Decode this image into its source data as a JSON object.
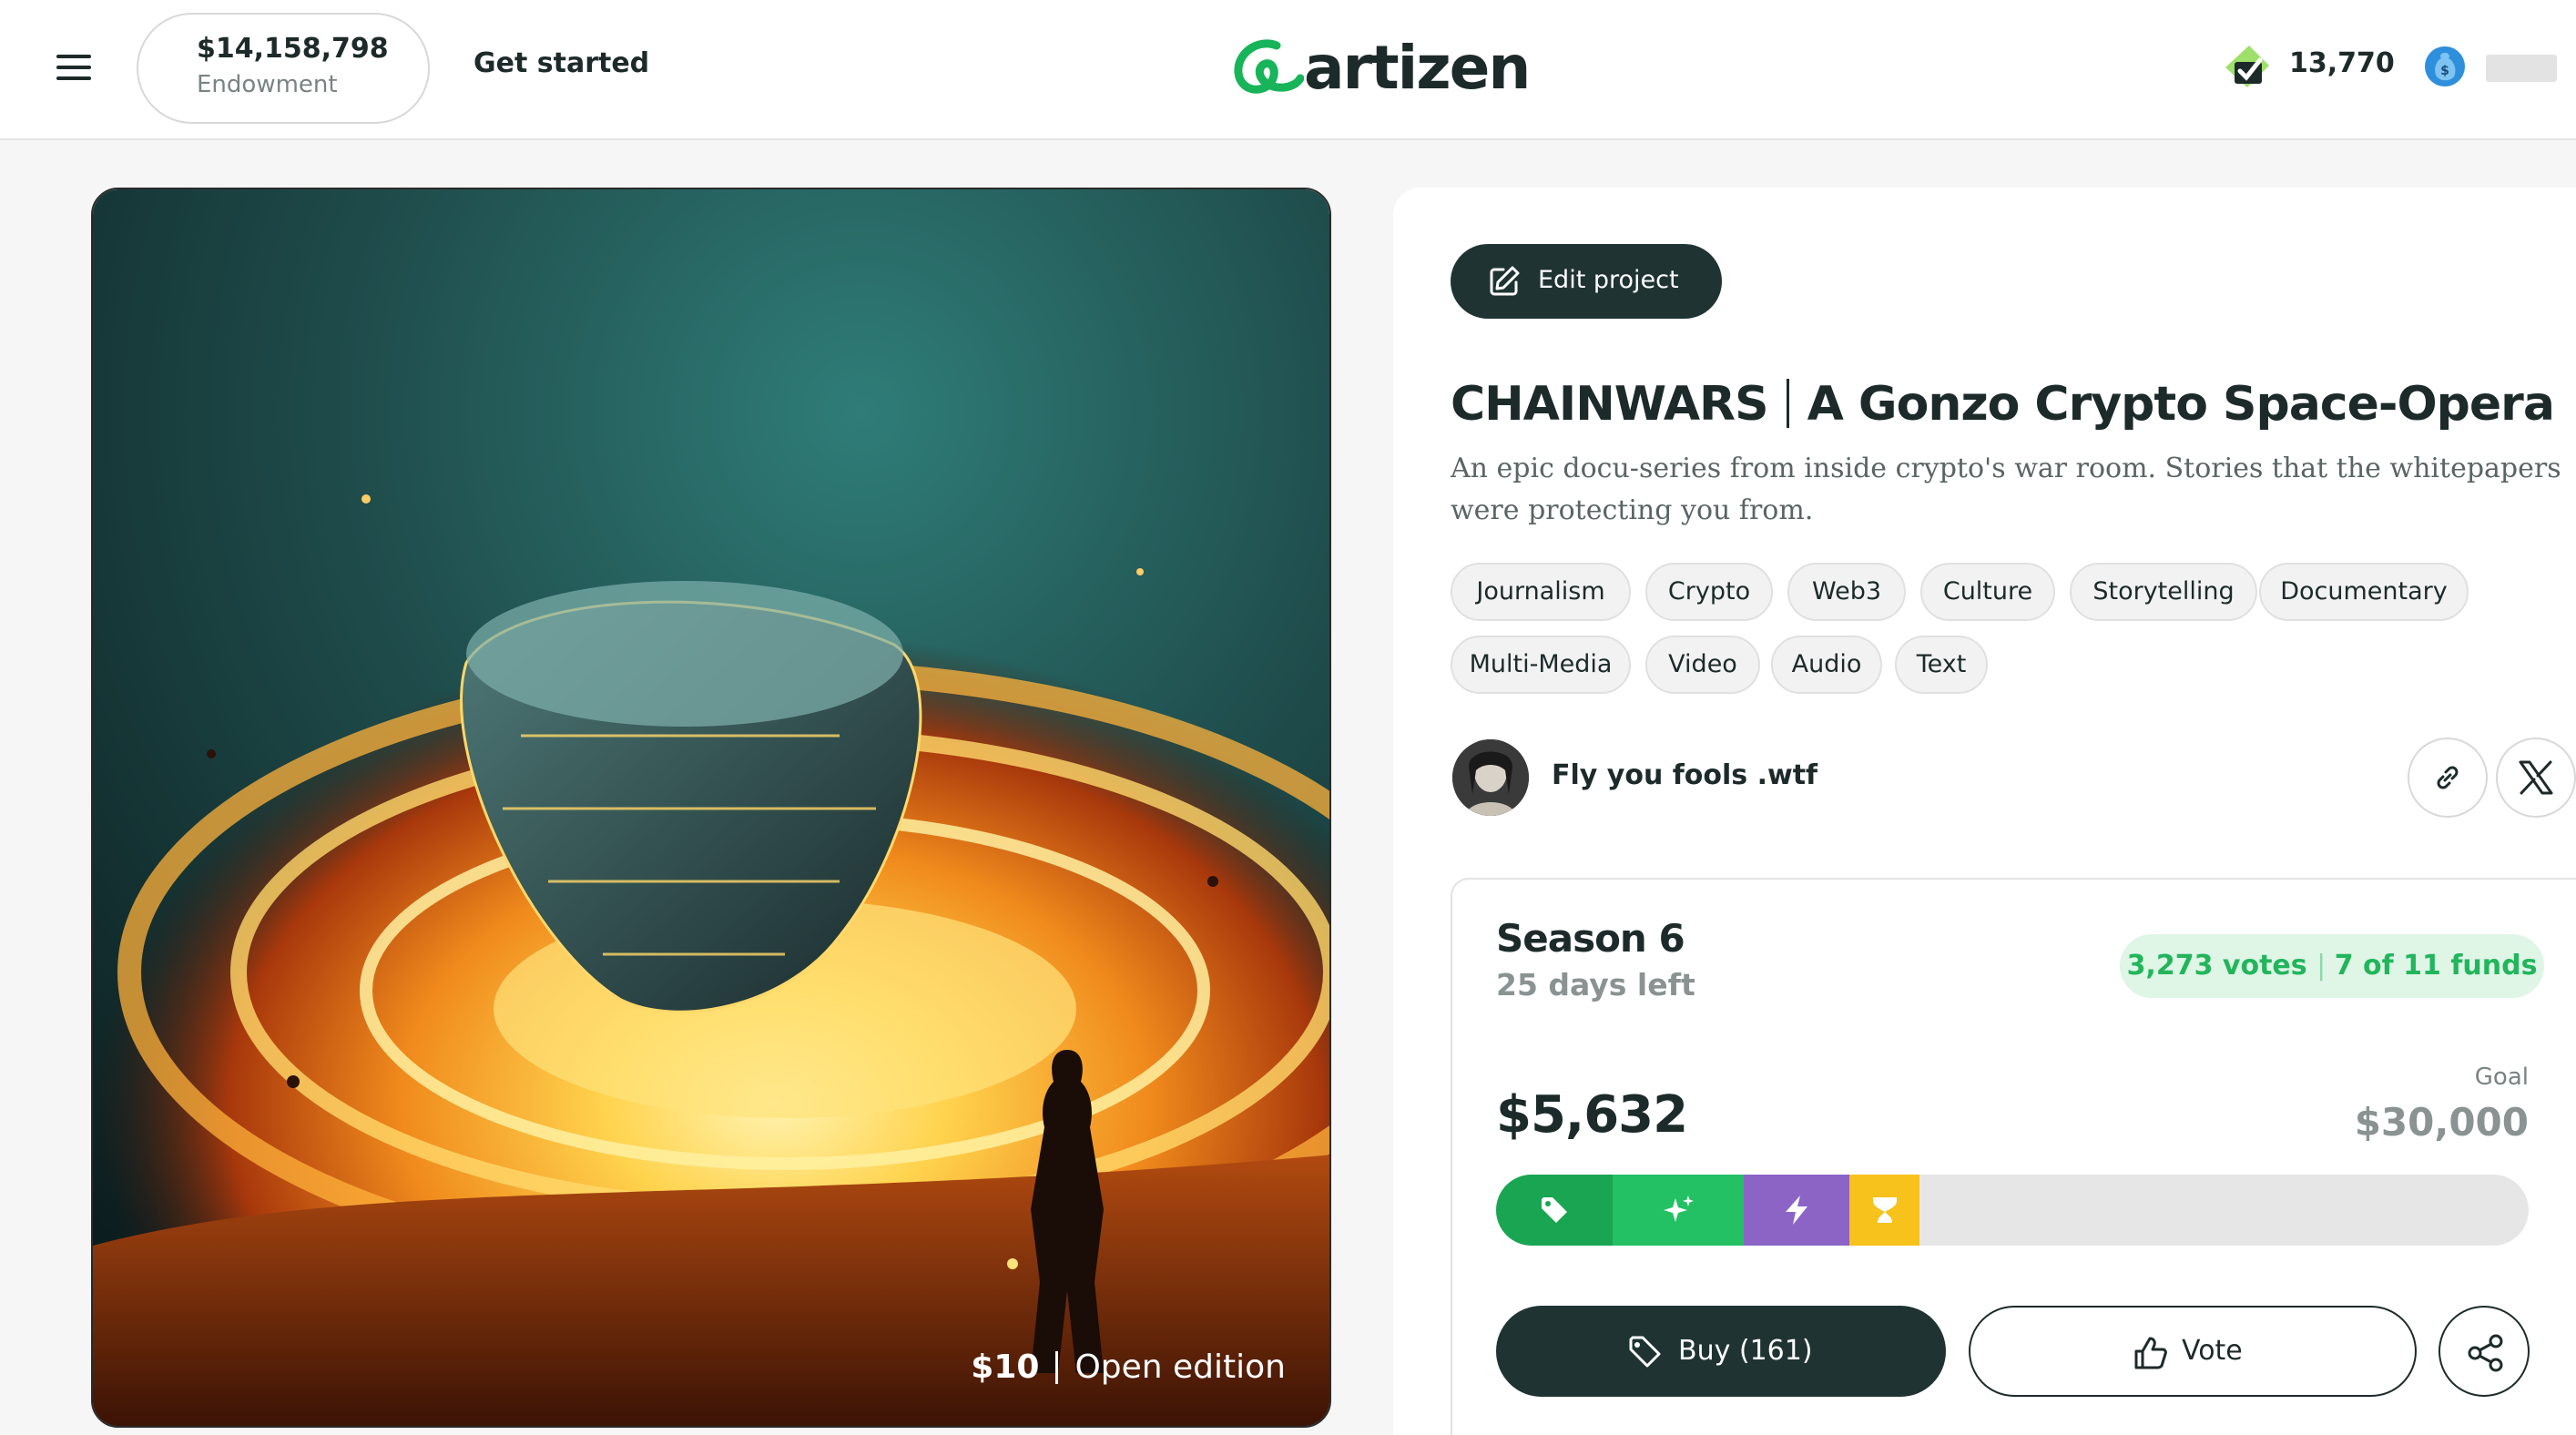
{
  "header": {
    "menu_icon": "hamburger-menu-icon",
    "endowment_amount": "$14,158,798",
    "endowment_label": "Endowment",
    "get_started": "Get started",
    "logo_text": "artizen",
    "points_icon": "ticket-check-icon",
    "points_value": "13,770",
    "coin_icon": "money-bag-icon"
  },
  "artwork": {
    "price": "$10",
    "edition": "Open edition"
  },
  "project": {
    "edit_label": "Edit project",
    "title_main": "CHAINWARS",
    "title_sub": "A Gonzo Crypto Space-Opera",
    "description": "An epic docu-series from inside crypto's war room. Stories that the whitepapers were protecting you from.",
    "tags": [
      "Journalism",
      "Crypto",
      "Web3",
      "Culture",
      "Storytelling",
      "Documentary",
      "Multi-Media",
      "Video",
      "Audio",
      "Text"
    ],
    "creator": "Fly you fools .wtf",
    "link_icon": "link-icon",
    "x_icon": "x-logo-icon"
  },
  "season": {
    "name": "Season 6",
    "days_left": "25 days left",
    "votes": "3,273 votes",
    "funds": "7 of 11 funds",
    "raised": "$5,632",
    "goal_label": "Goal",
    "goal": "$30,000",
    "progress_fraction": 0.41,
    "segments": [
      {
        "icon": "tag-icon",
        "color": "#1aa552"
      },
      {
        "icon": "sparkles-icon",
        "color": "#23c164"
      },
      {
        "icon": "lightning-icon",
        "color": "#8b64c6"
      },
      {
        "icon": "trophy-icon",
        "color": "#f7c21b"
      }
    ],
    "buy_label": "Buy (161)",
    "vote_label": "Vote",
    "share_icon": "share-icon"
  }
}
